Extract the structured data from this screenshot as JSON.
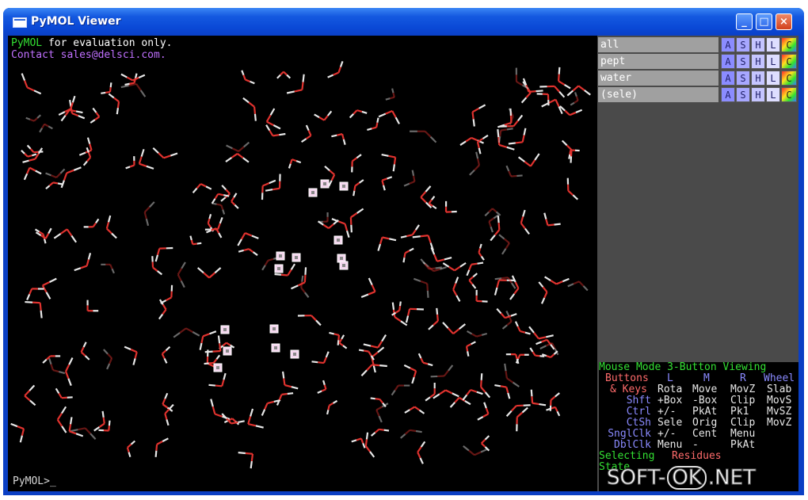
{
  "window": {
    "title": "PyMOL Viewer",
    "controls": {
      "minimize": "_",
      "maximize": "□",
      "close": "×"
    }
  },
  "viewer": {
    "line1_brand": "PyMOL",
    "line1_rest": " for evaluation only.",
    "line2": "Contact sales@delsci.com.",
    "prompt": "PyMOL>_"
  },
  "objects": [
    {
      "name": "all"
    },
    {
      "name": "pept"
    },
    {
      "name": "water"
    },
    {
      "name": "(sele)"
    }
  ],
  "object_buttons": [
    "A",
    "S",
    "H",
    "L",
    "C"
  ],
  "mouse": {
    "title": "Mouse Mode 3-Button Viewing",
    "header": {
      "a": "Buttons",
      "l": "L",
      "m": "M",
      "r": "R",
      "w": "Wheel"
    },
    "keys_label": "& Keys",
    "rows": [
      {
        "k": "",
        "l": "Rota",
        "m": "Move",
        "r": "MovZ",
        "w": "Slab"
      },
      {
        "k": "Shft",
        "l": "+Box",
        "m": "-Box",
        "r": "Clip",
        "w": "MovS"
      },
      {
        "k": "Ctrl",
        "l": "+/-",
        "m": "PkAt",
        "r": "Pk1",
        "w": "MvSZ"
      },
      {
        "k": "CtSh",
        "l": "Sele",
        "m": "Orig",
        "r": "Clip",
        "w": "MovZ"
      },
      {
        "k": "SnglClk",
        "l": "+/-",
        "m": "Cent",
        "r": "Menu",
        "w": ""
      },
      {
        "k": "DblClk",
        "l": "Menu",
        "m": "-",
        "r": "PkAt",
        "w": ""
      }
    ],
    "selecting_label": "Selecting",
    "selecting_value": "Residues",
    "state_line": "State"
  },
  "watermark": {
    "left": "SOFT-",
    "mid": "OK",
    "right": ".NET"
  },
  "colors": {
    "green": "#33e033",
    "red": "#ff6b6b",
    "blue": "#8a8aff",
    "cyan": "#4ad2ff",
    "orange": "#ff7a5a",
    "white": "#ffffff"
  }
}
